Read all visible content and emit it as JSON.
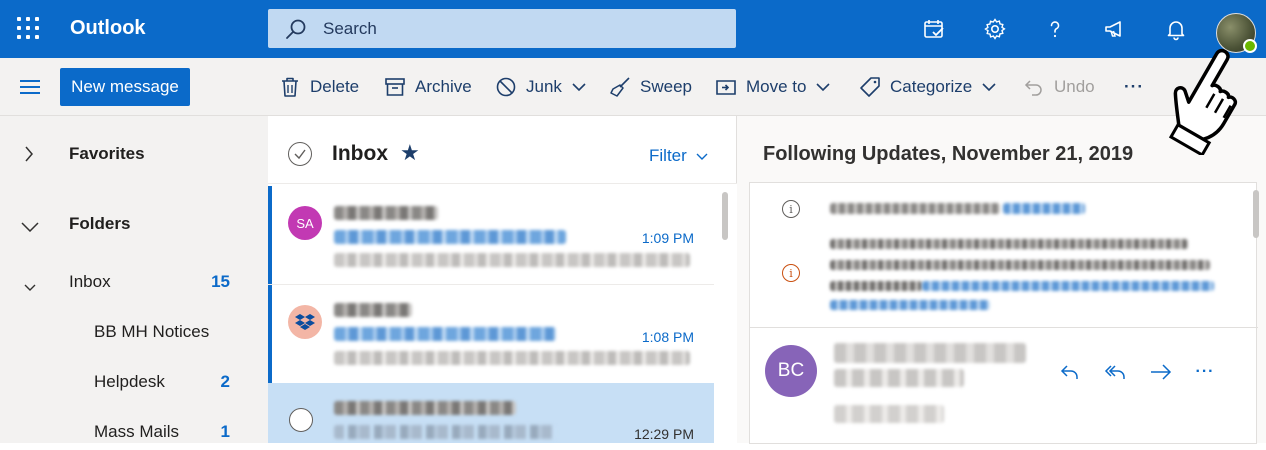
{
  "app": {
    "name": "Outlook"
  },
  "search": {
    "placeholder": "Search"
  },
  "toolbar": {
    "new_message": "New message",
    "delete": "Delete",
    "archive": "Archive",
    "junk": "Junk",
    "sweep": "Sweep",
    "move_to": "Move to",
    "categorize": "Categorize",
    "undo": "Undo",
    "more": "···"
  },
  "nav": {
    "favorites": "Favorites",
    "folders": "Folders",
    "inbox": {
      "label": "Inbox",
      "count": "15"
    },
    "items": [
      {
        "label": "BB MH Notices",
        "count": ""
      },
      {
        "label": "Helpdesk",
        "count": "2"
      },
      {
        "label": "Mass Mails",
        "count": "1"
      }
    ]
  },
  "list": {
    "title": "Inbox",
    "filter": "Filter",
    "messages": [
      {
        "initials": "SA",
        "avatar_color": "#c239b3",
        "time": "1:09 PM",
        "unread": true,
        "selected": false
      },
      {
        "initials": "",
        "avatar_color": "#f3b6a6",
        "time": "1:08 PM",
        "unread": true,
        "selected": false,
        "icon": "dropbox-icon"
      },
      {
        "initials": "",
        "avatar_color": "",
        "time": "12:29 PM",
        "unread": false,
        "selected": true
      }
    ]
  },
  "reading": {
    "subject": "Following Updates, November 21, 2019",
    "sender_initials": "BC",
    "sender_color": "#8764b8"
  },
  "colors": {
    "brand": "#0b6ac9",
    "presence": "#6bb700"
  }
}
